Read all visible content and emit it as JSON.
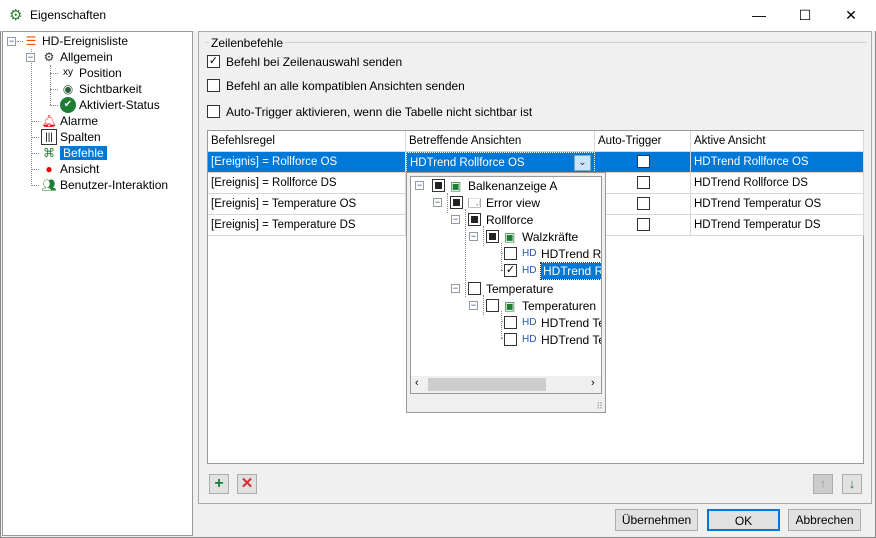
{
  "window": {
    "title": "Eigenschaften",
    "minimize": "—",
    "maximize": "☐",
    "close": "✕"
  },
  "tree": [
    {
      "label": "HD-Ereignisliste",
      "icon": "list-icon"
    },
    {
      "label": "Allgemein",
      "icon": "gear-icon"
    },
    {
      "label": "Position",
      "icon": "xy-icon"
    },
    {
      "label": "Sichtbarkeit",
      "icon": "eye-icon"
    },
    {
      "label": "Aktiviert-Status",
      "icon": "check-circle-icon"
    },
    {
      "label": "Alarme",
      "icon": "alarm-icon"
    },
    {
      "label": "Spalten",
      "icon": "columns-icon"
    },
    {
      "label": "Befehle",
      "icon": "command-icon",
      "selected": true
    },
    {
      "label": "Ansicht",
      "icon": "view-icon"
    },
    {
      "label": "Benutzer-Interaktion",
      "icon": "users-icon"
    }
  ],
  "group": {
    "title": "Zeilenbefehle"
  },
  "options": [
    {
      "label": "Befehl bei Zeilenauswahl senden",
      "checked": true
    },
    {
      "label": "Befehl an alle kompatiblen Ansichten senden",
      "checked": false
    },
    {
      "label": "Auto-Trigger aktivieren, wenn die Tabelle nicht sichtbar ist",
      "checked": false
    }
  ],
  "table": {
    "headers": [
      "Befehlsregel",
      "Betreffende Ansichten",
      "Auto-Trigger",
      "Aktive Ansicht"
    ],
    "rows": [
      {
        "rule": "[Ereignis] = Rollforce OS",
        "views": "HDTrend Rollforce OS",
        "auto": false,
        "active": "HDTrend Rollforce OS"
      },
      {
        "rule": "[Ereignis] = Rollforce DS",
        "views": "",
        "auto": false,
        "active": "HDTrend Rollforce DS"
      },
      {
        "rule": "[Ereignis] = Temperature OS",
        "views": "",
        "auto": false,
        "active": "HDTrend Temperatur OS"
      },
      {
        "rule": "[Ereignis] = Temperature DS",
        "views": "",
        "auto": false,
        "active": "HDTrend Temperatur DS"
      }
    ]
  },
  "dropdown": {
    "items": [
      {
        "label": "Balkenanzeige A",
        "state": "partial"
      },
      {
        "label": "Error view",
        "state": "partial"
      },
      {
        "label": "Rollforce",
        "state": "partial"
      },
      {
        "label": "Walzkräfte",
        "state": "partial"
      },
      {
        "label": "HDTrend Roll",
        "state": "unchecked"
      },
      {
        "label": "HDTrend Rol",
        "state": "checked",
        "selected": true
      },
      {
        "label": "Temperature",
        "state": "unchecked"
      },
      {
        "label": "Temperaturen",
        "state": "unchecked"
      },
      {
        "label": "HDTrend Ten",
        "state": "unchecked"
      },
      {
        "label": "HDTrend Ten",
        "state": "unchecked"
      }
    ]
  },
  "buttons": {
    "apply": "Übernehmen",
    "ok": "OK",
    "cancel": "Abbrechen"
  },
  "colors": {
    "selection": "#0078d7",
    "add": "#1e7d32",
    "delete": "#d32f2f"
  }
}
